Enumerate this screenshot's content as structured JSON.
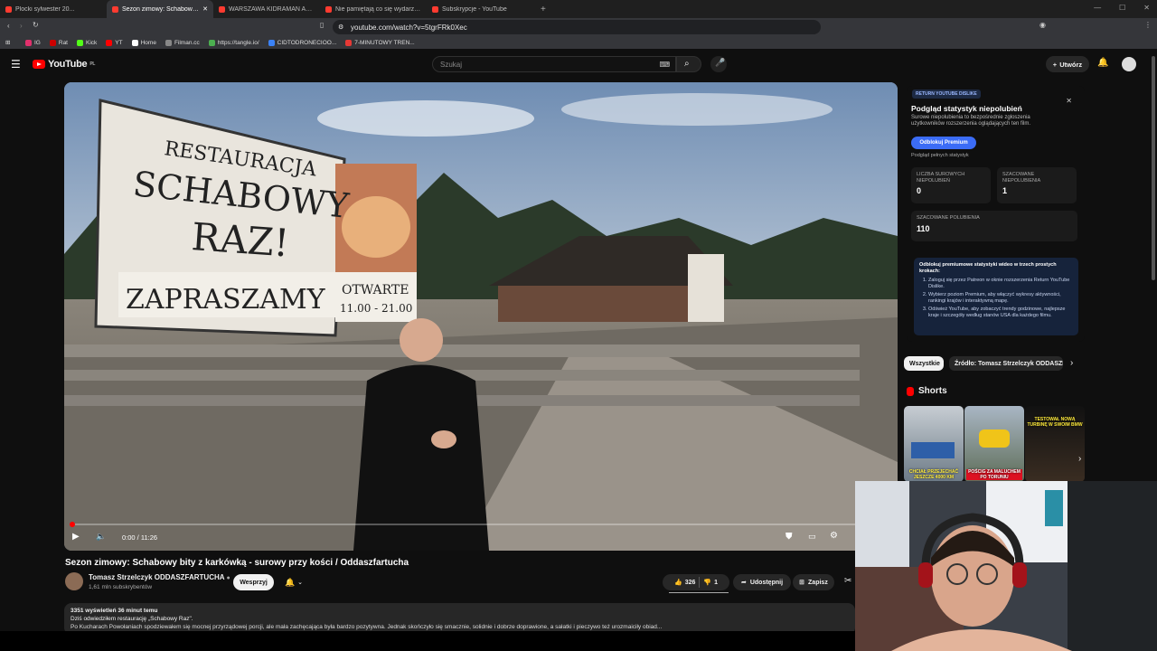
{
  "browser": {
    "tabs": [
      {
        "label": "Plocki sylwester 20..."
      },
      {
        "label": "Sezon zimowy: Schabowy bity z ...",
        "active": true
      },
      {
        "label": "WARSZAWA KIDRAMAN AUU - YouT..."
      },
      {
        "label": "Nie pamiętają co się wydarzyło w 20..."
      },
      {
        "label": "Subskrypcje - YouTube"
      }
    ],
    "url": "youtube.com/watch?v=5tgrFRk0Xec",
    "bookmarks": [
      "IG",
      "Rat",
      "Kick",
      "YT",
      "Home",
      "Filman.cc",
      "https://tangle.io/",
      "CIDTODRONECIOO...",
      "7-MINUTOWY TREN..."
    ]
  },
  "youtube": {
    "logo_text": "YouTube",
    "logo_region": "PL",
    "search_placeholder": "Szukaj",
    "create_label": "Utwórz"
  },
  "video": {
    "title": "Sezon zimowy: Schabowy bity z karkówką - surowy przy kości / Oddaszfartucha",
    "time_current": "0:00",
    "time_total": "11:26",
    "time_display": "0:00 / 11:26",
    "progress_fraction": 0.0,
    "sign_text": [
      "RESTAURACJA",
      "SCHABOWY",
      "RAZ!",
      "ZAPRASZAMY",
      "OTWARTE",
      "11.00 - 21.00"
    ]
  },
  "channel": {
    "name": "Tomasz Strzelczyk ODDASZFARTUCHA",
    "subscribers": "1,61 mln subskrybentów",
    "support_label": "Wesprzyj"
  },
  "actions": {
    "likes": "326",
    "dislikes": "1",
    "share_label": "Udostępnij",
    "save_label": "Zapisz"
  },
  "description": {
    "meta": "3351 wyświetleń  36 minut temu",
    "line1": "Dziś odwiedziłem restaurację „Schabowy Raz\".",
    "line2": "Po Kucharach Powołaniach spodziewałem się mocnej przyrządowej porcji, ale mała zachęcająca była bardzo pozytywna. Jednak skończyło się smacznie, solidnie i dobrze doprawione, a sałatki i pieczywo też urozmaiciły obiad..."
  },
  "ryd": {
    "badge": "RETURN YOUTUBE DISLIKE",
    "title": "Podgląd statystyk niepolubień",
    "desc": "Surowe niepolubienia to bezpośrednie zgłoszenia użytkowników rozszerzenia oglądających ten film.",
    "button": "Odblokuj Premium",
    "link": "Podgląd pełnych statystyk",
    "stat1_label": "LICZBA SUROWYCH NIEPOLUBIEŃ",
    "stat1_value": "0",
    "stat2_label": "SZACOWANE NIEPOLUBIENIA",
    "stat2_value": "1",
    "stat3_label": "SZACOWANE POLUBIENIA",
    "stat3_value": "110",
    "box_head": "Odblokuj premiumowe statystyki wideo w trzech prostych krokach:",
    "step1": "Zaloguj się przez Patreon w oknie rozszerzenia Return YouTube Dislike.",
    "step2": "Wybierz poziom Premium, aby włączyć wykresy aktywności, rankingi krajów i interaktywną mapę.",
    "step3": "Odśwież YouTube, aby zobaczyć trendy godzinowe, najlepsze kraje i szczegóły według stanów USA dla każdego filmu."
  },
  "chips": [
    "Wszystkie",
    "Źródło: Tomasz Strzelczyk ODDASZFA..."
  ],
  "shorts": {
    "heading": "Shorts",
    "items": [
      {
        "caption": "CHCIAŁ PRZEJECHAĆ JESZCZE 4000 KM"
      },
      {
        "caption": "POŚCIG ZA MALUCHEM PO TORUNIU"
      },
      {
        "caption": "TESTOWAŁ NOWĄ TURBINĘ W SWOIM BMW"
      }
    ]
  },
  "colors": {
    "bg": "#0f0f0f",
    "accent_red": "#ff0000",
    "ryd_blue": "#3b6cf6"
  }
}
